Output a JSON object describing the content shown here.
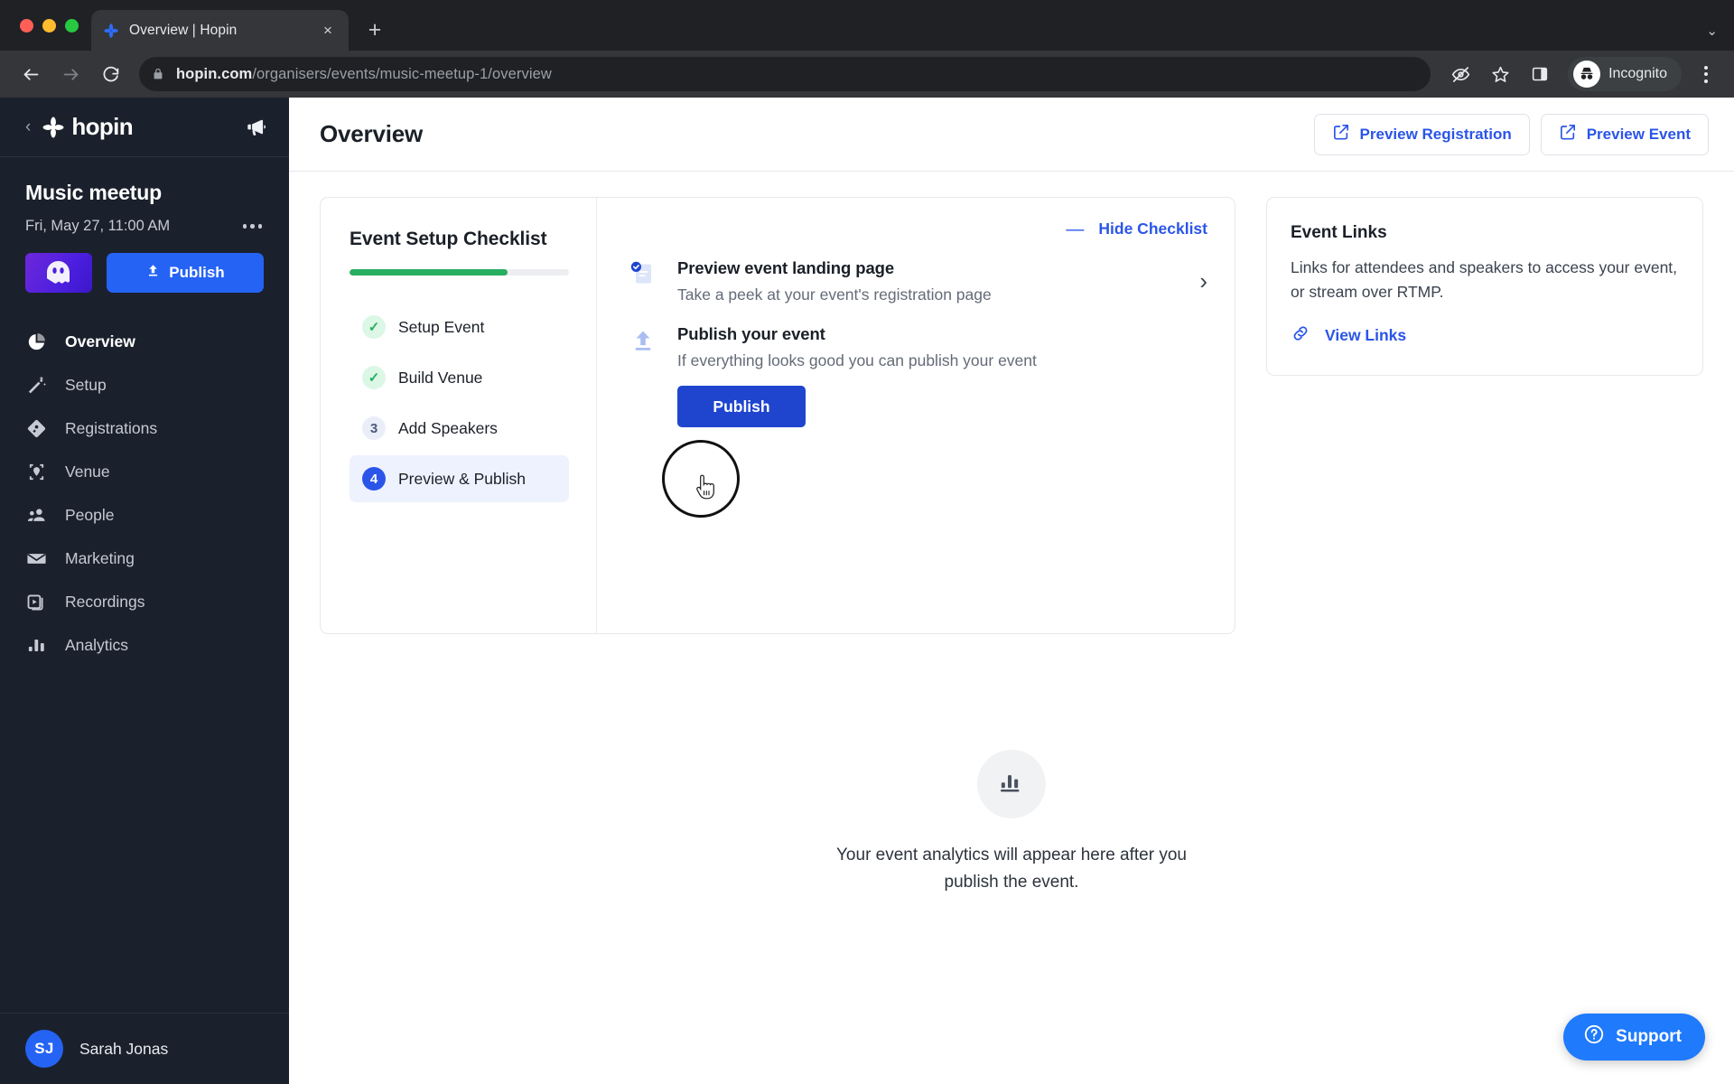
{
  "browser": {
    "tab": {
      "title": "Overview | Hopin",
      "favicon": "hopin-logo-icon",
      "close_label": "×"
    },
    "new_tab_label": "+",
    "tabstrip_chevron": "⌄",
    "back_label": "←",
    "forward_label": "→",
    "reload_label": "⟳",
    "url_host": "hopin.com",
    "url_path": "/organisers/events/music-meetup-1/overview",
    "profile_label": "Incognito",
    "icons": {
      "lock": "lock-icon",
      "eye_off": "eye-off-icon",
      "star": "bookmark-star-icon",
      "side_panel": "side-panel-icon",
      "incognito": "incognito-icon",
      "menu": "browser-menu-icon"
    }
  },
  "sidebar": {
    "brand": "hopin",
    "back_chevron": "‹",
    "announcements_icon": "megaphone-icon",
    "event": {
      "name": "Music meetup",
      "date": "Fri, May 27, 11:00 AM",
      "more_label": "•••",
      "thumbnail_icon": "ghost-avatar-icon",
      "publish_label": "Publish"
    },
    "nav": [
      {
        "label": "Overview",
        "icon": "pie-chart-icon",
        "active": true
      },
      {
        "label": "Setup",
        "icon": "magic-wand-icon",
        "active": false
      },
      {
        "label": "Registrations",
        "icon": "ticket-icon",
        "active": false
      },
      {
        "label": "Venue",
        "icon": "map-pin-icon",
        "active": false
      },
      {
        "label": "People",
        "icon": "people-icon",
        "active": false
      },
      {
        "label": "Marketing",
        "icon": "envelope-icon",
        "active": false
      },
      {
        "label": "Recordings",
        "icon": "video-library-icon",
        "active": false
      },
      {
        "label": "Analytics",
        "icon": "bar-chart-icon",
        "active": false
      }
    ],
    "user": {
      "initials": "SJ",
      "name": "Sarah Jonas"
    }
  },
  "header": {
    "title": "Overview",
    "preview_registration": "Preview Registration",
    "preview_event": "Preview Event",
    "external_icon": "external-link-icon"
  },
  "checklist": {
    "title": "Event Setup Checklist",
    "progress_percent": 72,
    "steps": [
      {
        "label": "Setup Event",
        "badge": "✓",
        "state": "done"
      },
      {
        "label": "Build Venue",
        "badge": "✓",
        "state": "done"
      },
      {
        "label": "Add Speakers",
        "badge": "3",
        "state": "todo"
      },
      {
        "label": "Preview & Publish",
        "badge": "4",
        "state": "active"
      }
    ],
    "hide_label": "Hide Checklist",
    "hide_icon": "minus-icon",
    "tasks": [
      {
        "title": "Preview event landing page",
        "desc": "Take a peek at your event's registration page",
        "icon": "document-checked-icon",
        "arrow": "›"
      },
      {
        "title": "Publish your event",
        "desc": "If everything looks good you can publish your event",
        "icon": "upload-arrow-icon",
        "button": "Publish"
      }
    ]
  },
  "event_links": {
    "title": "Event Links",
    "description": "Links for attendees and speakers to access your event, or stream over RTMP.",
    "link_label": "View Links",
    "link_icon": "chain-link-icon"
  },
  "empty_state": {
    "icon": "bar-chart-icon",
    "text": "Your event analytics will appear here after you publish the event."
  },
  "support": {
    "label": "Support",
    "icon": "question-circle-icon"
  },
  "colors": {
    "sidebar_bg": "#1b212c",
    "accent_blue": "#2b55e8",
    "publish_blue": "#1f45cf",
    "sidebar_publish_blue": "#2563f5",
    "progress_green": "#27ae60",
    "support_blue": "#1f7afc"
  }
}
